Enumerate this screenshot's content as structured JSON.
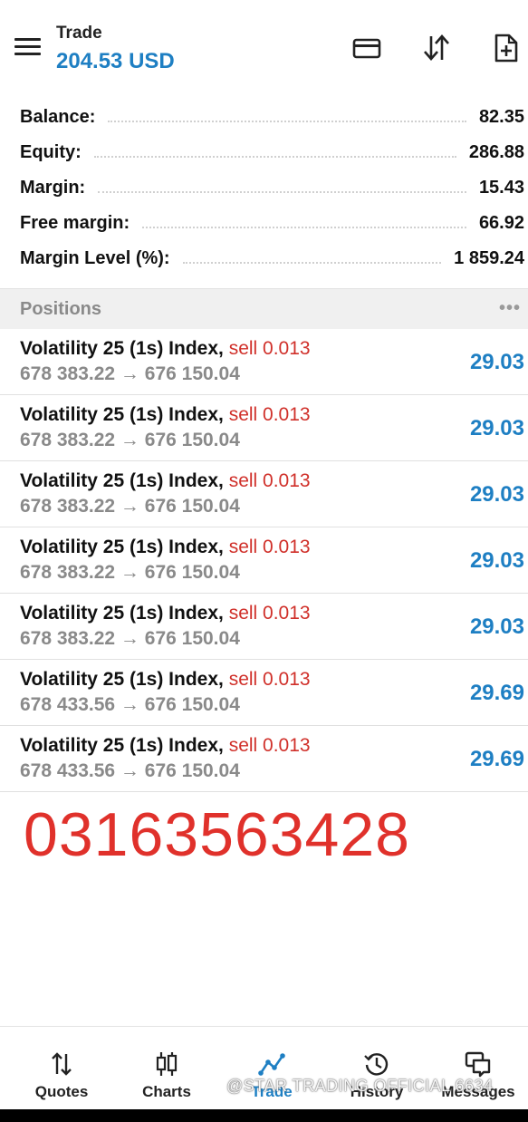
{
  "header": {
    "title": "Trade",
    "balance_display": "204.53 USD"
  },
  "account": [
    {
      "label": "Balance:",
      "value": "82.35"
    },
    {
      "label": "Equity:",
      "value": "286.88"
    },
    {
      "label": "Margin:",
      "value": "15.43"
    },
    {
      "label": "Free margin:",
      "value": "66.92"
    },
    {
      "label": "Margin Level (%):",
      "value": "1 859.24"
    }
  ],
  "positions": {
    "title": "Positions",
    "more": "•••",
    "items": [
      {
        "symbol": "Volatility 25 (1s) Index,",
        "side": "sell 0.013",
        "prices": "678 383.22 → 676 150.04",
        "profit": "29.03"
      },
      {
        "symbol": "Volatility 25 (1s) Index,",
        "side": "sell 0.013",
        "prices": "678 383.22 → 676 150.04",
        "profit": "29.03"
      },
      {
        "symbol": "Volatility 25 (1s) Index,",
        "side": "sell 0.013",
        "prices": "678 383.22 → 676 150.04",
        "profit": "29.03"
      },
      {
        "symbol": "Volatility 25 (1s) Index,",
        "side": "sell 0.013",
        "prices": "678 383.22 → 676 150.04",
        "profit": "29.03"
      },
      {
        "symbol": "Volatility 25 (1s) Index,",
        "side": "sell 0.013",
        "prices": "678 383.22 → 676 150.04",
        "profit": "29.03"
      },
      {
        "symbol": "Volatility 25 (1s) Index,",
        "side": "sell 0.013",
        "prices": "678 433.56 → 676 150.04",
        "profit": "29.69"
      },
      {
        "symbol": "Volatility 25 (1s) Index,",
        "side": "sell 0.013",
        "prices": "678 433.56 → 676 150.04",
        "profit": "29.69"
      }
    ]
  },
  "overlay_phone": "03163563428",
  "nav": {
    "items": [
      {
        "label": "Quotes",
        "icon": "quotes-icon"
      },
      {
        "label": "Charts",
        "icon": "charts-icon"
      },
      {
        "label": "Trade",
        "icon": "trade-icon",
        "active": true
      },
      {
        "label": "History",
        "icon": "history-icon"
      },
      {
        "label": "Messages",
        "icon": "messages-icon"
      }
    ]
  },
  "watermark": "@STAR TRADING OFFICIAL 6634",
  "colors": {
    "accent": "#1e7fc3",
    "sell": "#d0302a",
    "overlay_text": "#e0312b"
  }
}
